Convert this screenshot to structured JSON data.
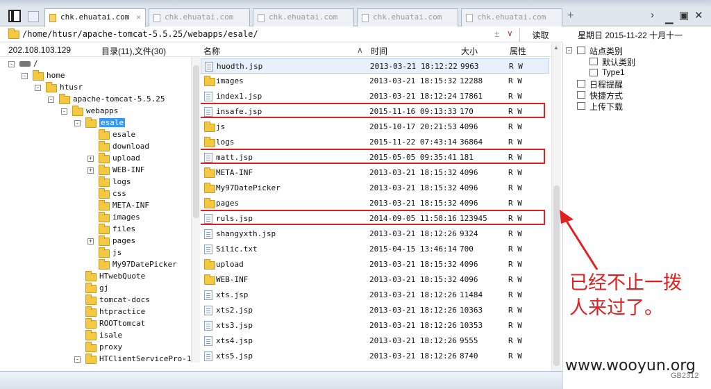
{
  "tabs": [
    {
      "label": "chk.ehuatai.com",
      "active": true
    },
    {
      "label": "chk.ehuatai.com",
      "active": false
    },
    {
      "label": "chk.ehuatai.com",
      "active": false
    },
    {
      "label": "chk.ehuatai.com",
      "active": false
    },
    {
      "label": "chk.ehuatai.com",
      "active": false
    }
  ],
  "address": {
    "path": "/home/htusr/apache-tomcat-5.5.25/webapps/esale/",
    "read_label": "读取"
  },
  "datebar": {
    "text": "星期日 2015-11-22 十月十一"
  },
  "tree": {
    "ip": "202.108.103.129",
    "count": "目录(11),文件(30)",
    "nodes": [
      {
        "label": "/",
        "depth": 0,
        "exp": "-"
      },
      {
        "label": "home",
        "depth": 1,
        "exp": "-"
      },
      {
        "label": "htusr",
        "depth": 2,
        "exp": "-"
      },
      {
        "label": "apache-tomcat-5.5.25",
        "depth": 3,
        "exp": "-"
      },
      {
        "label": "webapps",
        "depth": 4,
        "exp": "-"
      },
      {
        "label": "esale",
        "depth": 5,
        "exp": "-",
        "selected": true
      },
      {
        "label": "esale",
        "depth": 6,
        "exp": ""
      },
      {
        "label": "download",
        "depth": 6,
        "exp": ""
      },
      {
        "label": "upload",
        "depth": 6,
        "exp": "+"
      },
      {
        "label": "WEB-INF",
        "depth": 6,
        "exp": "+"
      },
      {
        "label": "logs",
        "depth": 6,
        "exp": ""
      },
      {
        "label": "css",
        "depth": 6,
        "exp": ""
      },
      {
        "label": "META-INF",
        "depth": 6,
        "exp": ""
      },
      {
        "label": "images",
        "depth": 6,
        "exp": ""
      },
      {
        "label": "files",
        "depth": 6,
        "exp": ""
      },
      {
        "label": "pages",
        "depth": 6,
        "exp": "+"
      },
      {
        "label": "js",
        "depth": 6,
        "exp": ""
      },
      {
        "label": "My97DatePicker",
        "depth": 6,
        "exp": ""
      },
      {
        "label": "HTwebQuote",
        "depth": 5,
        "exp": ""
      },
      {
        "label": "gj",
        "depth": 5,
        "exp": ""
      },
      {
        "label": "tomcat-docs",
        "depth": 5,
        "exp": ""
      },
      {
        "label": "htpractice",
        "depth": 5,
        "exp": ""
      },
      {
        "label": "ROOTtomcat",
        "depth": 5,
        "exp": ""
      },
      {
        "label": "isale",
        "depth": 5,
        "exp": ""
      },
      {
        "label": "proxy",
        "depth": 5,
        "exp": ""
      },
      {
        "label": "HTClientServicePro-1",
        "depth": 5,
        "exp": "-"
      }
    ]
  },
  "list": {
    "headers": {
      "name": "名称",
      "time": "时间",
      "size": "大小",
      "attr": "属性"
    },
    "rows": [
      {
        "name": "huodth.jsp",
        "time": "2013-03-21 18:12:22",
        "size": "9963",
        "attr": "R W",
        "type": "file",
        "selected": true
      },
      {
        "name": "images",
        "time": "2013-03-21 18:15:32",
        "size": "12288",
        "attr": "R W",
        "type": "folder"
      },
      {
        "name": "index1.jsp",
        "time": "2013-03-21 18:12:24",
        "size": "17861",
        "attr": "R W",
        "type": "file"
      },
      {
        "name": "insafe.jsp",
        "time": "2015-11-16 09:13:33",
        "size": "170",
        "attr": "R W",
        "type": "file",
        "highlight": true
      },
      {
        "name": "js",
        "time": "2015-10-17 20:21:53",
        "size": "4096",
        "attr": "R W",
        "type": "folder"
      },
      {
        "name": "logs",
        "time": "2015-11-22 07:43:14",
        "size": "36864",
        "attr": "R W",
        "type": "folder"
      },
      {
        "name": "matt.jsp",
        "time": "2015-05-05 09:35:41",
        "size": "181",
        "attr": "R W",
        "type": "file",
        "highlight": true
      },
      {
        "name": "META-INF",
        "time": "2013-03-21 18:15:32",
        "size": "4096",
        "attr": "R W",
        "type": "folder"
      },
      {
        "name": "My97DatePicker",
        "time": "2013-03-21 18:15:32",
        "size": "4096",
        "attr": "R W",
        "type": "folder"
      },
      {
        "name": "pages",
        "time": "2013-03-21 18:15:32",
        "size": "4096",
        "attr": "R W",
        "type": "folder"
      },
      {
        "name": "ruls.jsp",
        "time": "2014-09-05 11:58:16",
        "size": "123945",
        "attr": "R W",
        "type": "file",
        "highlight": true
      },
      {
        "name": "shangyxth.jsp",
        "time": "2013-03-21 18:12:26",
        "size": "9324",
        "attr": "R W",
        "type": "file"
      },
      {
        "name": "Silic.txt",
        "time": "2015-04-15 13:46:14",
        "size": "700",
        "attr": "R W",
        "type": "file"
      },
      {
        "name": "upload",
        "time": "2013-03-21 18:15:32",
        "size": "4096",
        "attr": "R W",
        "type": "folder"
      },
      {
        "name": "WEB-INF",
        "time": "2013-03-21 18:15:32",
        "size": "4096",
        "attr": "R W",
        "type": "folder"
      },
      {
        "name": "xts.jsp",
        "time": "2013-03-21 18:12:26",
        "size": "11484",
        "attr": "R W",
        "type": "file"
      },
      {
        "name": "xts2.jsp",
        "time": "2013-03-21 18:12:26",
        "size": "10363",
        "attr": "R W",
        "type": "file"
      },
      {
        "name": "xts3.jsp",
        "time": "2013-03-21 18:12:26",
        "size": "10353",
        "attr": "R W",
        "type": "file"
      },
      {
        "name": "xts4.jsp",
        "time": "2013-03-21 18:12:26",
        "size": "9555",
        "attr": "R W",
        "type": "file"
      },
      {
        "name": "xts5.jsp",
        "time": "2013-03-21 18:12:26",
        "size": "8740",
        "attr": "R W",
        "type": "file"
      }
    ]
  },
  "right_panel": {
    "items": [
      {
        "label": "站点类别",
        "depth": 0,
        "exp": "-"
      },
      {
        "label": "默认类别",
        "depth": 1,
        "exp": ""
      },
      {
        "label": "Type1",
        "depth": 1,
        "exp": ""
      },
      {
        "label": "日程提醒",
        "depth": 0,
        "exp": ""
      },
      {
        "label": "快捷方式",
        "depth": 0,
        "exp": ""
      },
      {
        "label": "上传下载",
        "depth": 0,
        "exp": ""
      }
    ]
  },
  "annotation": {
    "line1": "已经不止一拨",
    "line2": "人来过了。"
  },
  "watermark": "www.wooyun.org",
  "corner_text": "GB2312",
  "colors": {
    "highlight": "#e02020",
    "selection": "#3399ff",
    "folder": "#f5c842"
  }
}
